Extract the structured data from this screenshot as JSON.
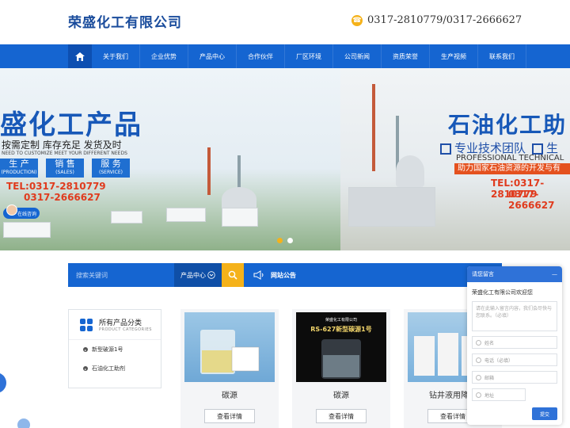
{
  "header": {
    "logo": "荣盛化工有限公司",
    "phone": "0317-2810779/0317-2666627"
  },
  "nav": {
    "items": [
      "关于我们",
      "企业优势",
      "产品中心",
      "合作伙伴",
      "厂区环境",
      "公司新闻",
      "资质荣誉",
      "生产视频",
      "联系我们"
    ]
  },
  "banner": {
    "left": {
      "title": "盛化工产品",
      "subtitle": "按需定制  库存充足  发货及时",
      "english": "NEED TO CUSTOMIZE MEET YOUR DIFFERENT NEEDS",
      "services": [
        {
          "cn": "生 产",
          "en": "(PRODUCTION)"
        },
        {
          "cn": "销 售",
          "en": "(SALES)"
        },
        {
          "cn": "服 务",
          "en": "(SERVICE)"
        }
      ],
      "tel1": "TEL:0317-2810779",
      "tel2": "0317-2666627",
      "online": "在线咨询"
    },
    "right": {
      "title": "石油化工助",
      "features": [
        "专业技术团队",
        "生"
      ],
      "english": "PROFESSIONAL TECHNICAL",
      "slogan": "助力国家石油资源的开发与有",
      "tel1": "TEL:0317-2810779",
      "tel2": "0317-2666627"
    }
  },
  "search": {
    "placeholder": "搜索关键词",
    "select_label": "产品中心",
    "notice_label": "网站公告"
  },
  "sidebar": {
    "title": "所有产品分类",
    "subtitle": "PRODUCT CATEGORIES",
    "items": [
      "新型破源1号",
      "石油化工助剂"
    ]
  },
  "products": [
    {
      "name": "碳源",
      "button": "查看详情"
    },
    {
      "name": "碳源",
      "button": "查看详情",
      "label_top": "荣盛化工有限公司",
      "label": "RS-627新型碳源1号"
    },
    {
      "name": "钻井液用降滤",
      "button": "查看详情"
    }
  ],
  "message": {
    "title": "请您留言",
    "collapse": "—",
    "welcome": "荣盛化工有限公司欢迎您",
    "textarea_placeholder": "请在此输入留言内容，我们会尽快与您联系。（必填）",
    "fields": [
      "姓名",
      "电话（必填）",
      "邮箱",
      "地址"
    ],
    "submit": "提交"
  },
  "colors": {
    "primary": "#1565d1",
    "accent": "#f5b21a",
    "logo": "#1a4c9c",
    "alert": "#e03b1e"
  }
}
